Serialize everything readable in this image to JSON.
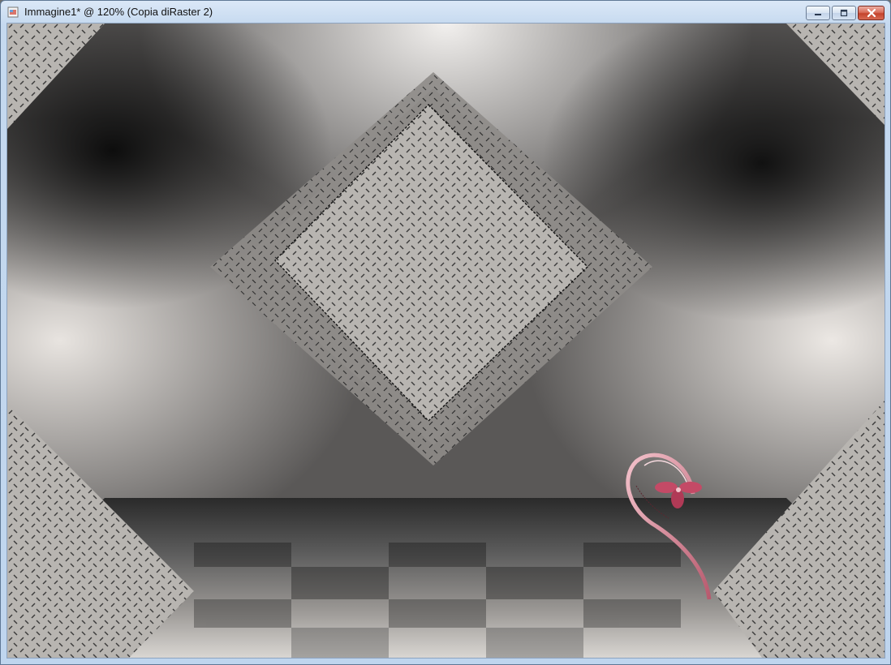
{
  "window": {
    "title": "Immagine1* @ 120% (Copia diRaster 2)"
  },
  "controls": {
    "minimize_icon": "minimize-icon",
    "maximize_icon": "maximize-icon",
    "close_icon": "close-icon"
  },
  "canvas": {
    "description_icon": "image-canvas",
    "colors": {
      "close_red": "#c4432c",
      "frame_blue": "#bfd5ee",
      "diamond_gray": "#9e9e9e",
      "signature_pink": "#d98a9a"
    }
  }
}
